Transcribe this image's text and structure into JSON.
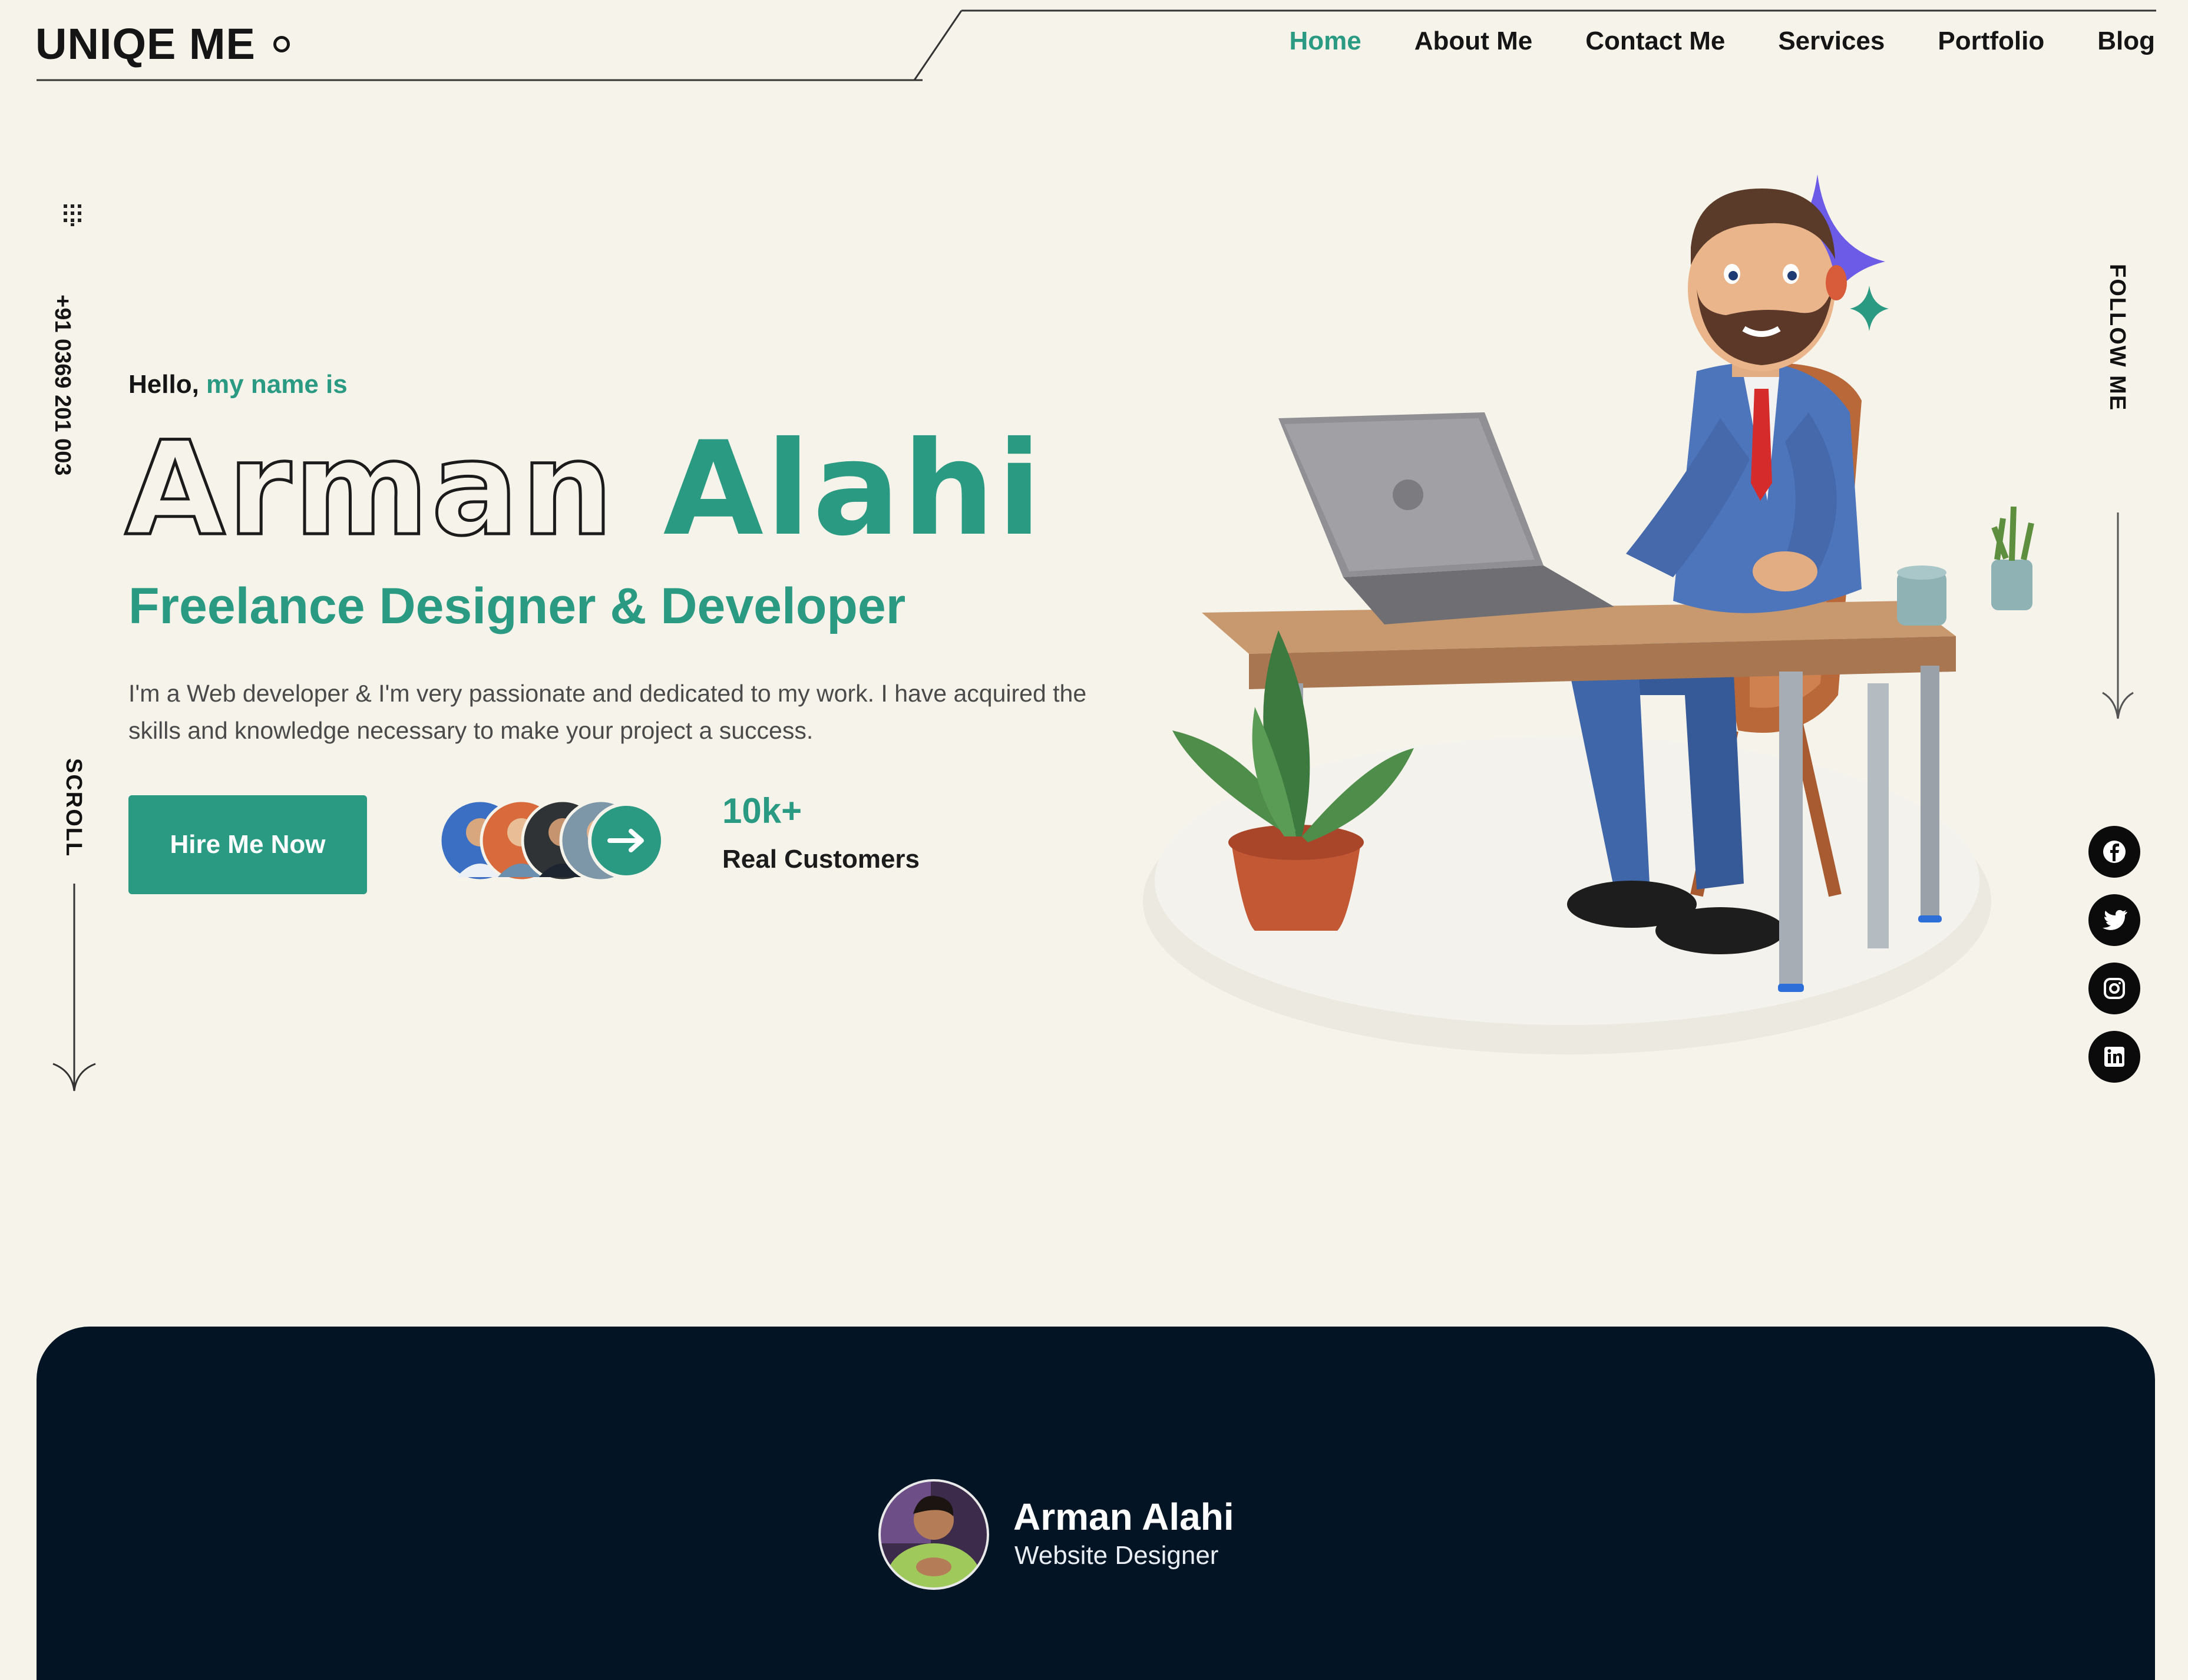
{
  "header": {
    "logo": "UNIQE ME",
    "nav": [
      {
        "label": "Home",
        "active": true
      },
      {
        "label": "About Me",
        "active": false
      },
      {
        "label": "Contact Me",
        "active": false
      },
      {
        "label": "Services",
        "active": false
      },
      {
        "label": "Portfolio",
        "active": false
      },
      {
        "label": "Blog",
        "active": false
      }
    ]
  },
  "left_rail": {
    "grid_icon": "dots-grid-icon",
    "phone": "+91 0369 201 003",
    "scroll_label": "SCROLL"
  },
  "right_rail": {
    "follow_label": "FOLLOW ME",
    "socials": [
      {
        "name": "facebook-icon"
      },
      {
        "name": "twitter-icon"
      },
      {
        "name": "instagram-icon"
      },
      {
        "name": "linkedin-icon"
      }
    ]
  },
  "hero": {
    "greeting_prefix": "Hello,",
    "greeting_accent": "my name is",
    "first_name": "Arman",
    "last_name": "Alahi",
    "role": "Freelance Designer & Developer",
    "description": "I'm a Web developer & I'm very passionate and dedicated to my work. I have acquired the skills and knowledge necessary to make your project a success.",
    "cta": "Hire Me Now",
    "customers_value": "10k+",
    "customers_label": "Real Customers"
  },
  "profile": {
    "name": "Arman Alahi",
    "title": "Website Designer"
  },
  "colors": {
    "background": "#f6f3ea",
    "accent": "#2a9a82",
    "dark": "#031425",
    "sparkle": "#6b5be6"
  }
}
